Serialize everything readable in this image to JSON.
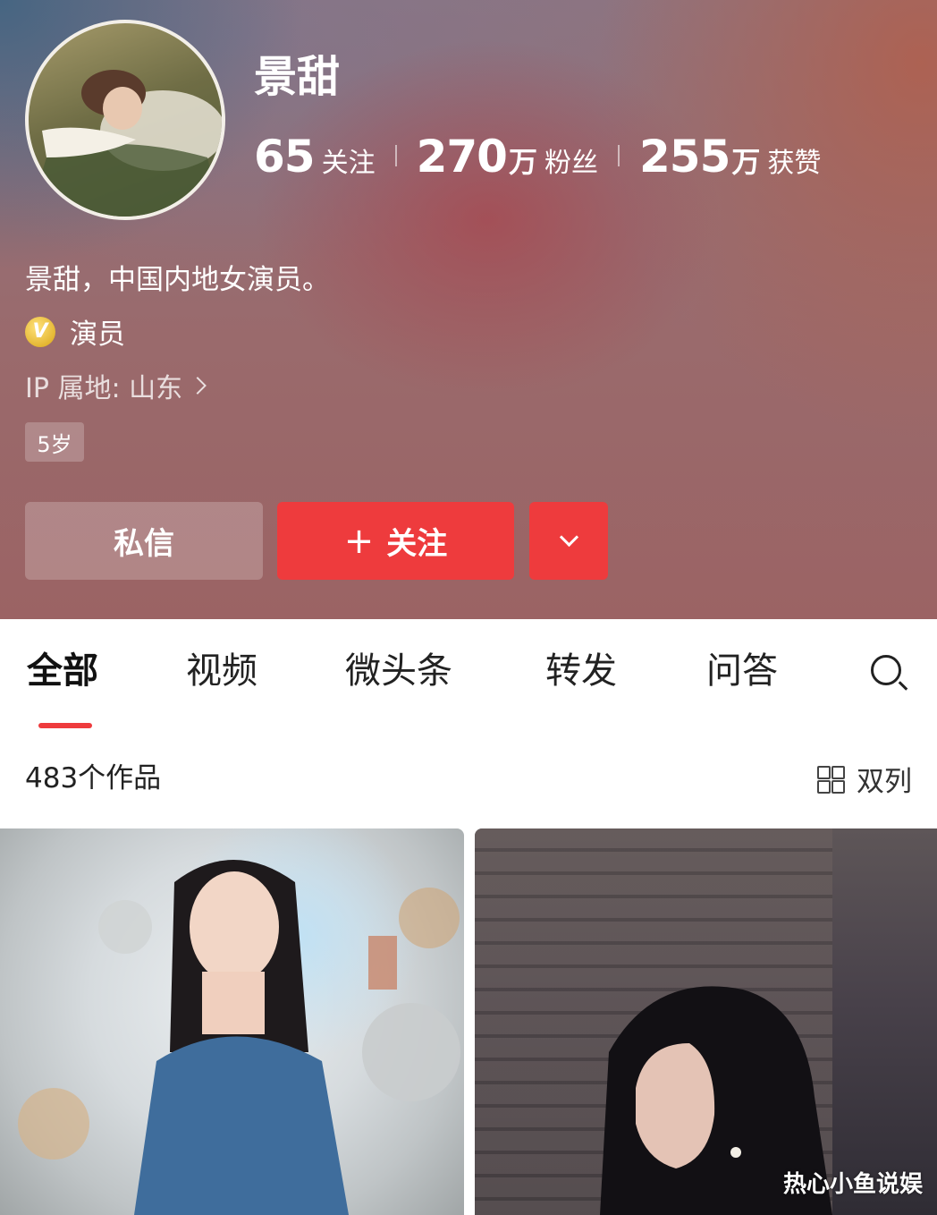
{
  "profile": {
    "name": "景甜",
    "bio": "景甜，中国内地女演员。",
    "certification": "演员",
    "verified_badge_letter": "V",
    "ip_location": "IP 属地: 山东",
    "age_tag": "5岁",
    "avatar_icon": "avatar-photo"
  },
  "stats": {
    "following": {
      "value": "65",
      "unit": "",
      "label": "关注"
    },
    "followers": {
      "value": "270",
      "unit": "万",
      "label": "粉丝"
    },
    "likes": {
      "value": "255",
      "unit": "万",
      "label": "获赞"
    }
  },
  "actions": {
    "message_label": "私信",
    "follow_label": "关注",
    "follow_prefix": "+",
    "more_icon": "chevron-down-icon"
  },
  "tabs": [
    {
      "label": "全部",
      "active": true
    },
    {
      "label": "视频",
      "active": false
    },
    {
      "label": "微头条",
      "active": false
    },
    {
      "label": "转发",
      "active": false
    },
    {
      "label": "问答",
      "active": false
    }
  ],
  "works": {
    "count_label": "483个作品",
    "layout_label": "双列",
    "layout_icon": "grid-icon"
  },
  "watermark": "热心小鱼说娱",
  "colors": {
    "accent": "#ee3b3d",
    "tab_indicator": "#ee3b3d"
  }
}
